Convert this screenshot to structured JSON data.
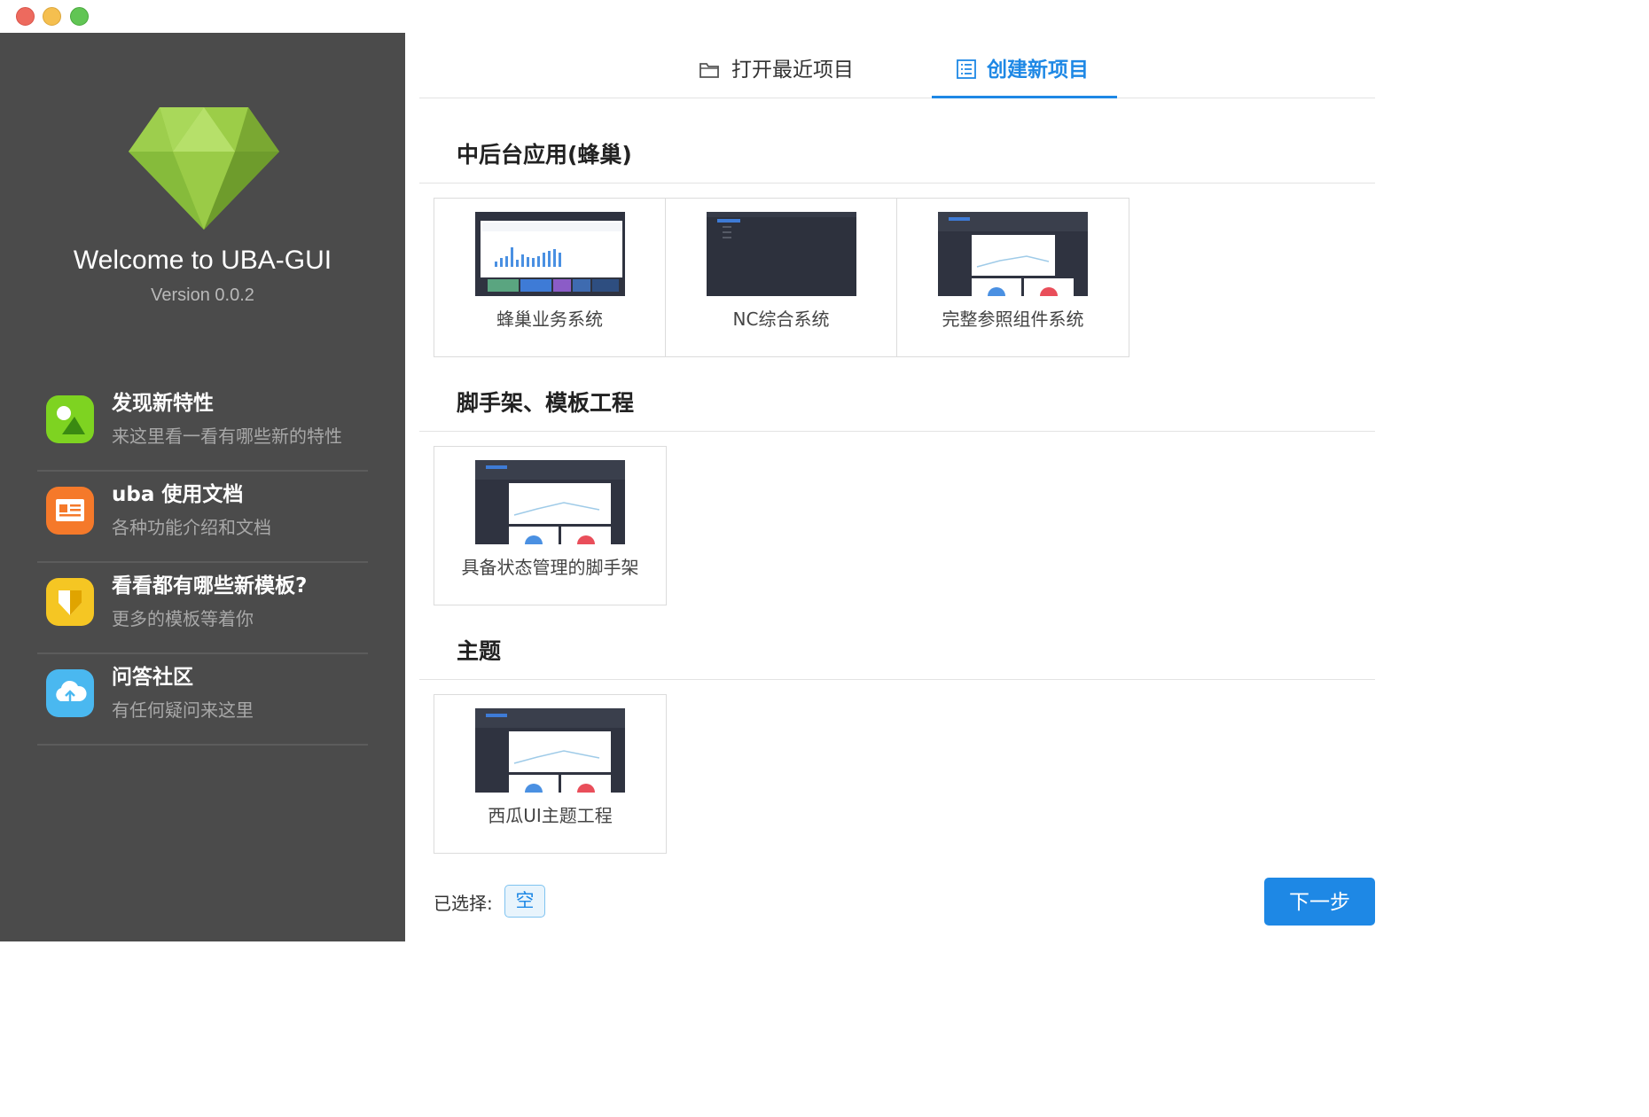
{
  "sidebar": {
    "welcome": "Welcome to UBA-GUI",
    "version": "Version 0.0.2",
    "items": [
      {
        "title": "发现新特性",
        "desc": "来这里看一看有哪些新的特性",
        "icon": "image-icon",
        "color": "#7ed321"
      },
      {
        "title": "uba 使用文档",
        "desc": "各种功能介绍和文档",
        "icon": "document-icon",
        "color": "#f5792a"
      },
      {
        "title": "看看都有哪些新模板?",
        "desc": "更多的模板等着你",
        "icon": "diamond-icon",
        "color": "#f5c623"
      },
      {
        "title": "问答社区",
        "desc": "有任何疑问来这里",
        "icon": "cloud-upload-icon",
        "color": "#4ab8f0"
      }
    ]
  },
  "tabs": {
    "open_recent": "打开最近项目",
    "create_new": "创建新项目"
  },
  "sections": [
    {
      "title": "中后台应用(蜂巢)",
      "cards": [
        "蜂巢业务系统",
        "NC综合系统",
        "完整参照组件系统"
      ]
    },
    {
      "title": "脚手架、模板工程",
      "cards": [
        "具备状态管理的脚手架"
      ]
    },
    {
      "title": "主题",
      "cards": [
        "西瓜UI主题工程"
      ]
    }
  ],
  "footer": {
    "selected_label": "已选择:",
    "selected_value": "空",
    "next_button": "下一步"
  },
  "colors": {
    "accent": "#1e88e5",
    "sidebar_bg": "#4b4b4b"
  }
}
